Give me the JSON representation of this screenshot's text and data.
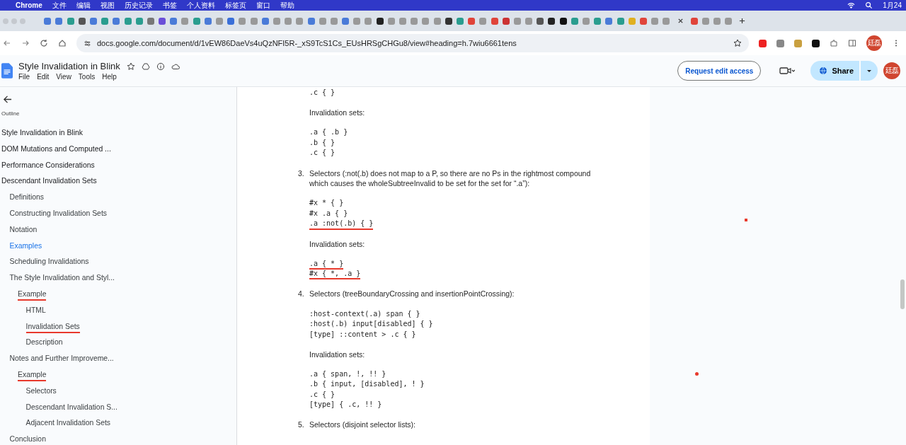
{
  "menubar": {
    "app": "Chrome",
    "items": [
      "文件",
      "编辑",
      "视图",
      "历史记录",
      "书签",
      "个人资料",
      "标签页",
      "窗口",
      "帮助"
    ],
    "clock": "1月24"
  },
  "address_bar": {
    "url": "docs.google.com/document/d/1vEW86DaeVs4uQzNFI5R-_xS9TcS1Cs_EUsHRSgCHGu8/view#heading=h.7wiu6661tens"
  },
  "doc_header": {
    "title": "Style Invalidation in Blink",
    "menu": [
      "File",
      "Edit",
      "View",
      "Tools",
      "Help"
    ],
    "request_button": "Request edit access",
    "share_button": "Share",
    "avatar": "廷磊",
    "profile_avatar": "廷磊"
  },
  "outline": {
    "heading": "Outline",
    "items": [
      {
        "label": "Style Invalidation in Blink",
        "selected": false,
        "underlined": false
      },
      {
        "label": "DOM Mutations and Computed ...",
        "selected": false,
        "underlined": false
      },
      {
        "label": "Performance Considerations",
        "selected": false,
        "underlined": false
      },
      {
        "label": "Descendant Invalidation Sets",
        "selected": false,
        "underlined": false,
        "children": [
          {
            "label": "Definitions",
            "selected": false,
            "underlined": false
          },
          {
            "label": "Constructing Invalidation Sets",
            "selected": false,
            "underlined": false
          },
          {
            "label": "Notation",
            "selected": false,
            "underlined": false
          },
          {
            "label": "Examples",
            "selected": true,
            "underlined": false
          },
          {
            "label": "Scheduling Invalidations",
            "selected": false,
            "underlined": false
          },
          {
            "label": "The Style Invalidation and Styl...",
            "selected": false,
            "underlined": false,
            "children": [
              {
                "label": "Example",
                "selected": false,
                "underlined": true,
                "children": [
                  {
                    "label": "HTML",
                    "selected": false,
                    "underlined": false
                  },
                  {
                    "label": "Invalidation Sets",
                    "selected": false,
                    "underlined": true
                  },
                  {
                    "label": "Description",
                    "selected": false,
                    "underlined": false
                  }
                ]
              }
            ]
          },
          {
            "label": "Notes and Further Improveme...",
            "selected": false,
            "underlined": false,
            "children": [
              {
                "label": "Example",
                "selected": false,
                "underlined": true,
                "children": [
                  {
                    "label": "Selectors",
                    "selected": false,
                    "underlined": false
                  },
                  {
                    "label": "Descendant Invalidation S...",
                    "selected": false,
                    "underlined": false
                  },
                  {
                    "label": "Adjacent Invalidation Sets",
                    "selected": false,
                    "underlined": false
                  }
                ]
              }
            ]
          },
          {
            "label": "Conclusion",
            "selected": false,
            "underlined": false
          }
        ]
      }
    ]
  },
  "document": {
    "blocks": [
      {
        "kind": "code",
        "lines": [
          {
            "text": ".c { }",
            "underlined": false
          }
        ]
      },
      {
        "kind": "text",
        "text": "Invalidation sets:"
      },
      {
        "kind": "code",
        "lines": [
          {
            "text": ".a { .b }",
            "underlined": false
          },
          {
            "text": ".b { }",
            "underlined": false
          },
          {
            "text": ".c { }",
            "underlined": false
          }
        ]
      },
      {
        "kind": "item",
        "number": "3.",
        "text": "Selectors (:not(.b) does not map to a P, so there are no Ps in the rightmost compound which causes the wholeSubtreeInvalid to be set for the set for “.a”):"
      },
      {
        "kind": "code",
        "lines": [
          {
            "text": "#x * { }",
            "underlined": false
          },
          {
            "text": "#x .a { }",
            "underlined": false
          },
          {
            "text": ".a :not(.b) { }",
            "underlined": true
          }
        ]
      },
      {
        "kind": "text",
        "text": "Invalidation sets:"
      },
      {
        "kind": "code",
        "lines": [
          {
            "text": ".a { * }",
            "underlined": true
          },
          {
            "text": "#x { *, .a }",
            "underlined": true
          }
        ]
      },
      {
        "kind": "item",
        "number": "4.",
        "text": "Selectors (treeBoundaryCrossing and insertionPointCrossing):"
      },
      {
        "kind": "code",
        "lines": [
          {
            "text": ":host-context(.a) span { }",
            "underlined": false
          },
          {
            "text": ":host(.b) input[disabled] { }",
            "underlined": false
          },
          {
            "text": "[type] ::content > .c { }",
            "underlined": false
          }
        ]
      },
      {
        "kind": "text",
        "text": "Invalidation sets:"
      },
      {
        "kind": "code",
        "lines": [
          {
            "text": ".a { span, !, !! }",
            "underlined": false
          },
          {
            "text": ".b { input, [disabled], ! }",
            "underlined": false
          },
          {
            "text": ".c { }",
            "underlined": false
          },
          {
            "text": "[type] { .c, !! }",
            "underlined": false
          }
        ]
      },
      {
        "kind": "item",
        "number": "5.",
        "text": "Selectors (disjoint selector lists):"
      }
    ]
  }
}
